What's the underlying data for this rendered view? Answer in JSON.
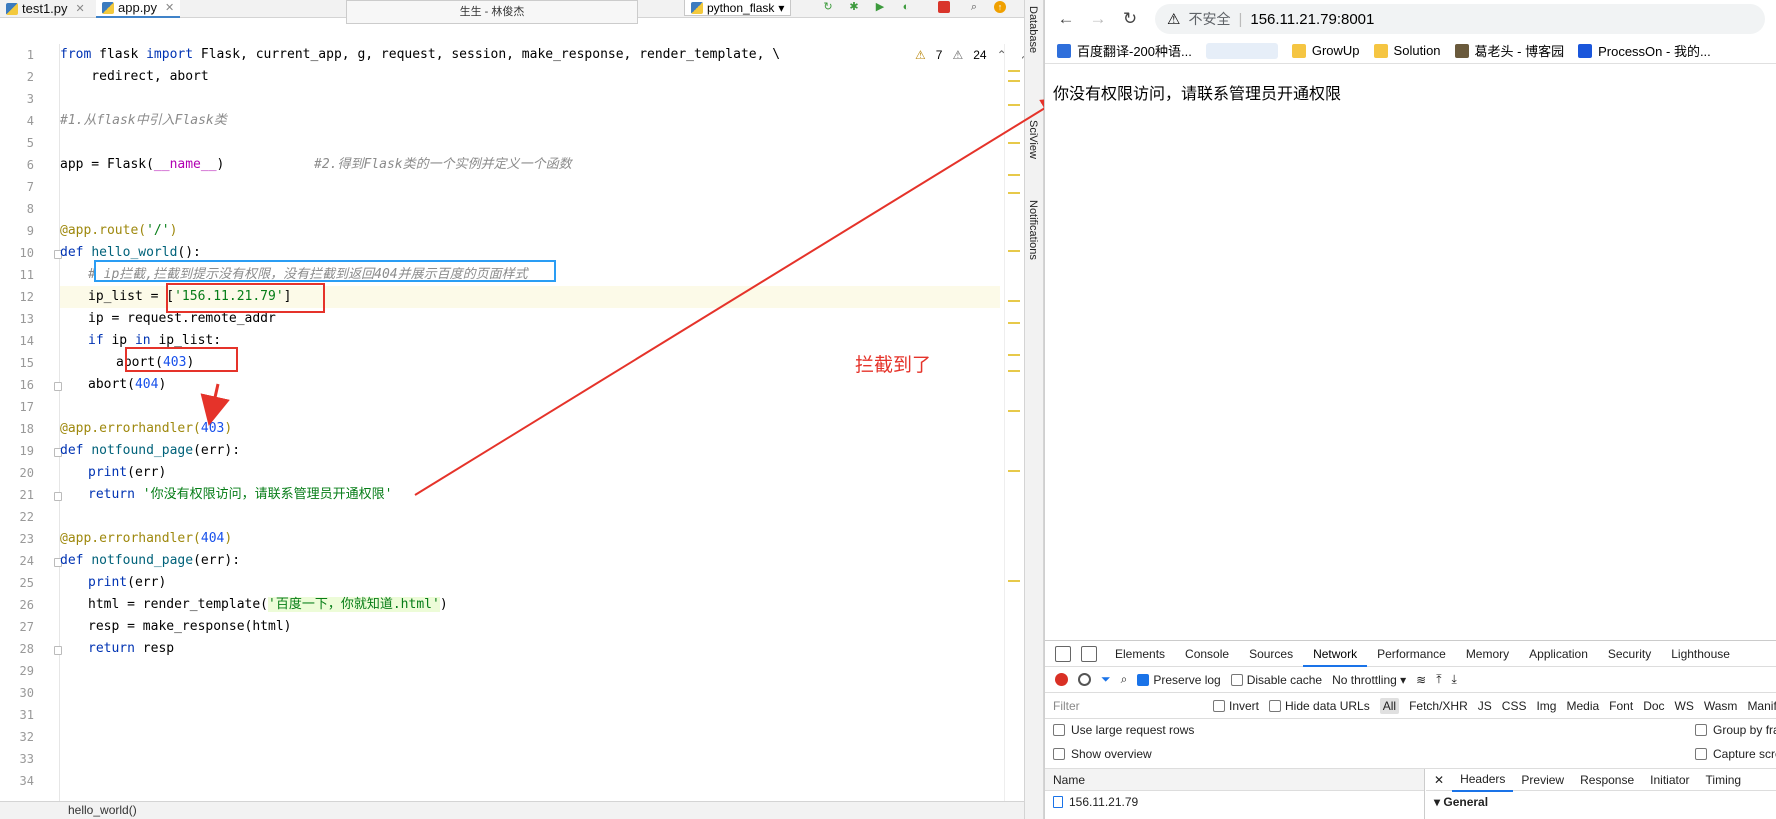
{
  "ide": {
    "tabs": [
      {
        "label": "test1.py"
      },
      {
        "label": "app.py"
      }
    ],
    "caption": "生生 - 林俊杰",
    "run_config": "python_flask",
    "inspection": {
      "warnings": "7",
      "weak_warnings": "24"
    },
    "side_panels": [
      "Database",
      "SciView",
      "Notifications"
    ],
    "status_breadcrumb": "hello_world()",
    "line_numbers": [
      "1",
      "2",
      "3",
      "4",
      "5",
      "6",
      "7",
      "8",
      "9",
      "10",
      "11",
      "12",
      "13",
      "14",
      "15",
      "16",
      "17",
      "18",
      "19",
      "20",
      "21",
      "22",
      "23",
      "24",
      "25",
      "26",
      "27",
      "28",
      "29",
      "30",
      "31",
      "32",
      "33",
      "34"
    ],
    "code": {
      "l1": {
        "kw1": "from",
        "mod": " flask ",
        "kw2": "import",
        "names": " Flask, current_app, g, request, session, make_response, render_template, \\"
      },
      "l2": "    redirect, abort",
      "l4": "#1.从flask中引入Flask类",
      "l6": {
        "pre": "app = Flask(",
        "dunder": "__name__",
        "post": ")",
        "comment": "#2.得到Flask类的一个实例并定义一个函数"
      },
      "l9": {
        "dec": "@app.route(",
        "str": "'/'",
        "post": ")"
      },
      "l10": {
        "kw": "def",
        "fn": "hello_world",
        "post": "():"
      },
      "l11": "# ip拦截,拦截到提示没有权限，没有拦截到返回404并展示百度的页面样式",
      "l12": {
        "pre": "ip_list = [",
        "str": "'156.11.21.79'",
        "post": "]"
      },
      "l13": "ip = request.remote_addr",
      "l14": {
        "kw1": "if",
        "mid": " ip ",
        "kw2": "in",
        "post": " ip_list:"
      },
      "l15": {
        "pre": "abort(",
        "num": "403",
        "post": ")"
      },
      "l16": {
        "pre": "abort(",
        "num": "404",
        "post": ")"
      },
      "l18": {
        "dec": "@app.errorhandler(",
        "num": "403",
        "post": ")"
      },
      "l19": {
        "kw": "def",
        "fn": "notfound_page",
        "post": "(err):"
      },
      "l20": {
        "kw": "print",
        "post": "(err)"
      },
      "l21": {
        "kw": "return",
        "str": "'你没有权限访问，请联系管理员开通权限'"
      },
      "l23": {
        "dec": "@app.errorhandler(",
        "num": "404",
        "post": ")"
      },
      "l24": {
        "kw": "def",
        "fn": "notfound_page",
        "post": "(err):"
      },
      "l25": {
        "kw": "print",
        "post": "(err)"
      },
      "l26": {
        "pre": "html = render_template(",
        "str": "'百度一下，你就知道.html'",
        "post": ")"
      },
      "l27": "resp = make_response(html)",
      "l28": {
        "kw": "return",
        "post": " resp"
      }
    },
    "annotation": "拦截到了"
  },
  "browser": {
    "address": "156.11.21.79:8001",
    "insecure_label": "不安全",
    "bookmarks": [
      {
        "label": "百度翻译-200种语...",
        "color": "#2f6fdb"
      },
      {
        "label": "GrowUp",
        "color": "#f5c542"
      },
      {
        "label": "Solution",
        "color": "#f5c542"
      },
      {
        "label": "葛老头 - 博客园",
        "color": "#6a5a3c"
      },
      {
        "label": "ProcessOn - 我的...",
        "color": "#1a56db"
      }
    ],
    "page_text": "你没有权限访问，请联系管理员开通权限",
    "devtools": {
      "tabs": [
        "Elements",
        "Console",
        "Sources",
        "Network",
        "Performance",
        "Memory",
        "Application",
        "Security",
        "Lighthouse"
      ],
      "active_tab": "Network",
      "preserve_log": "Preserve log",
      "disable_cache": "Disable cache",
      "throttling": "No throttling",
      "filter_placeholder": "Filter",
      "invert": "Invert",
      "hide_data_urls": "Hide data URLs",
      "types": [
        "All",
        "Fetch/XHR",
        "JS",
        "CSS",
        "Img",
        "Media",
        "Font",
        "Doc",
        "WS",
        "Wasm",
        "Manif"
      ],
      "opt_large_rows": "Use large request rows",
      "opt_overview": "Show overview",
      "opt_group": "Group by fra",
      "opt_capture": "Capture scre",
      "col_name": "Name",
      "row_name": "156.11.21.79",
      "detail_tabs": [
        "Headers",
        "Preview",
        "Response",
        "Initiator",
        "Timing"
      ],
      "general": "General"
    }
  }
}
